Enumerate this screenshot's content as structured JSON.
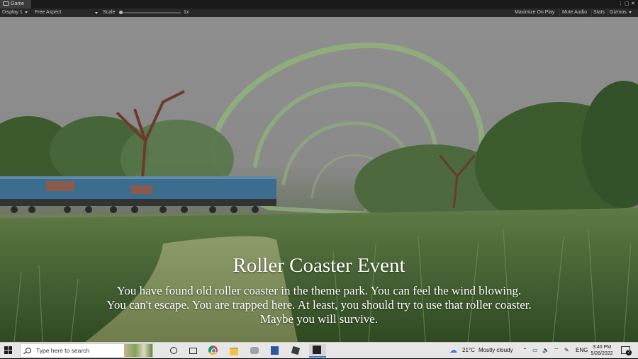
{
  "unity": {
    "tab_label": "Game",
    "toolbar": {
      "display": "Display 1",
      "aspect": "Free Aspect",
      "scale_label": "Scale",
      "scale_value": "1x",
      "maximize": "Maximize On Play",
      "mute": "Mute Audio",
      "stats": "Stats",
      "gizmos": "Gizmos"
    }
  },
  "game": {
    "title": "Roller Coaster Event",
    "description_lines": [
      "You have found old roller coaster in the theme park. You can feel the wind blowing.",
      "You can't escape. You are trapped here. At least, you should try to use that roller coaster.",
      "Maybe you will survive."
    ]
  },
  "taskbar": {
    "search_placeholder": "Type here to search",
    "weather_temp": "21°C",
    "weather_text": "Mostly cloudy",
    "language": "ENG",
    "time": "3:40 PM",
    "date": "5/26/2022",
    "notification_count": "2"
  }
}
